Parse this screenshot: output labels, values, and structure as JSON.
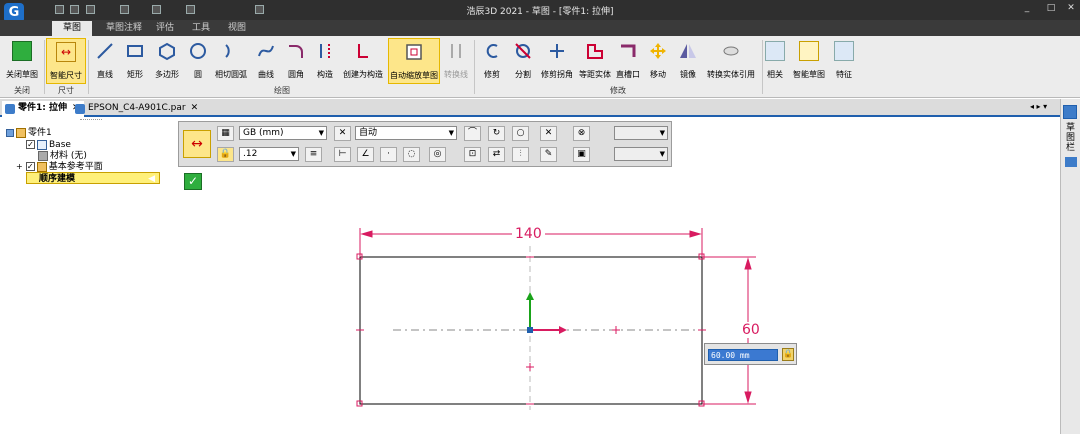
{
  "titlebar": {
    "title": "浩辰3D 2021 - 草图 - [零件1: 拉伸]"
  },
  "ribbon_tabs": [
    "草图",
    "草图注释",
    "评估",
    "工具",
    "视图"
  ],
  "ribbon": {
    "buttons": [
      "关闭草图",
      "智能尺寸",
      "直线",
      "矩形",
      "多边形",
      "圆",
      "相切圆弧",
      "曲线",
      "圆角",
      "构造",
      "创建为构造",
      "自动缩放草图",
      "转换线",
      "修剪",
      "分割",
      "修剪拐角",
      "等距实体",
      "直槽口",
      "移动",
      "镜像",
      "转换实体引用",
      "相关",
      "智能草图",
      "特征"
    ],
    "groups": [
      "关闭",
      "尺寸",
      "绘图",
      "修改"
    ]
  },
  "doc_tabs": [
    {
      "label": "零件1: 拉伸"
    },
    {
      "label": "EPSON_C4-A901C.par"
    }
  ],
  "tree": {
    "root": "零件1",
    "base": "Base",
    "material": "材料 (无)",
    "ref_planes": "基本参考平面",
    "ordered": "顺序建模"
  },
  "cmdbar": {
    "standard": "GB (mm)",
    "mode": "自动",
    "precision": ".12"
  },
  "sketch": {
    "width_dim": "140",
    "height_dim": "60",
    "entry_value": "60.00 mm"
  },
  "side_panel": {
    "label": "草图栏"
  },
  "colors": {
    "dimension": "#d81b60",
    "accent": "#1f5fad"
  }
}
